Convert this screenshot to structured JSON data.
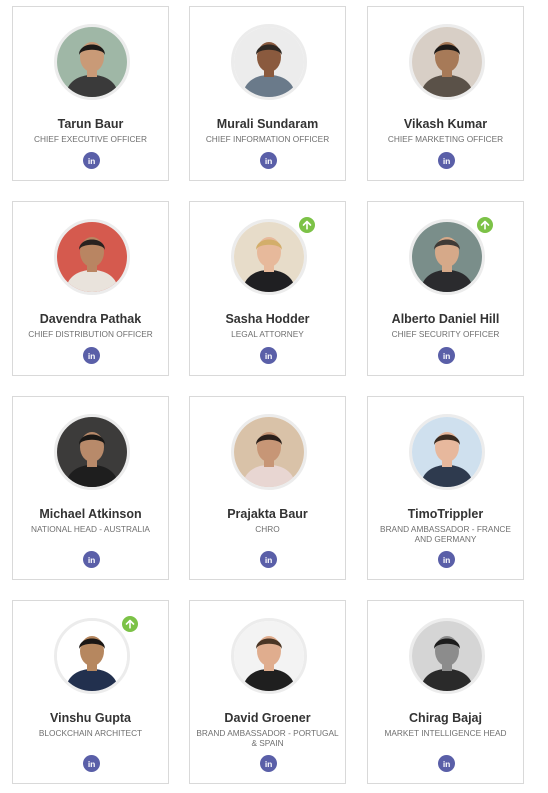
{
  "colors": {
    "linkedin": "#5a5fa8",
    "badge": "#7cc247",
    "name": "#333333",
    "title": "#6f6f6f",
    "card_border": "#d9d9d9"
  },
  "icons": {
    "linkedin": "linkedin-icon",
    "badge": "arrow-up-icon"
  },
  "linkedin_glyph": "in",
  "team": [
    {
      "name": "Tarun Baur",
      "title": "CHIEF EXECUTIVE OFFICER",
      "badge": false
    },
    {
      "name": "Murali Sundaram",
      "title": "CHIEF INFORMATION OFFICER",
      "badge": false
    },
    {
      "name": "Vikash Kumar",
      "title": "CHIEF MARKETING OFFICER",
      "badge": false
    },
    {
      "name": "Davendra Pathak",
      "title": "CHIEF DISTRIBUTION OFFICER",
      "badge": false
    },
    {
      "name": "Sasha Hodder",
      "title": "LEGAL ATTORNEY",
      "badge": true
    },
    {
      "name": "Alberto Daniel Hill",
      "title": "CHIEF SECURITY OFFICER",
      "badge": true
    },
    {
      "name": "Michael Atkinson",
      "title": "NATIONAL HEAD - AUSTRALIA",
      "badge": false
    },
    {
      "name": "Prajakta Baur",
      "title": "CHRO",
      "badge": false
    },
    {
      "name": "TimoTrippler",
      "title": "BRAND AMBASSADOR - FRANCE AND GERMANY",
      "badge": false
    },
    {
      "name": "Vinshu Gupta",
      "title": "BLOCKCHAIN ARCHITECT",
      "badge": true
    },
    {
      "name": "David Groener",
      "title": "BRAND AMBASSADOR - PORTUGAL & SPAIN",
      "badge": false
    },
    {
      "name": "Chirag Bajaj",
      "title": "MARKET INTELLIGENCE HEAD",
      "badge": false
    }
  ]
}
